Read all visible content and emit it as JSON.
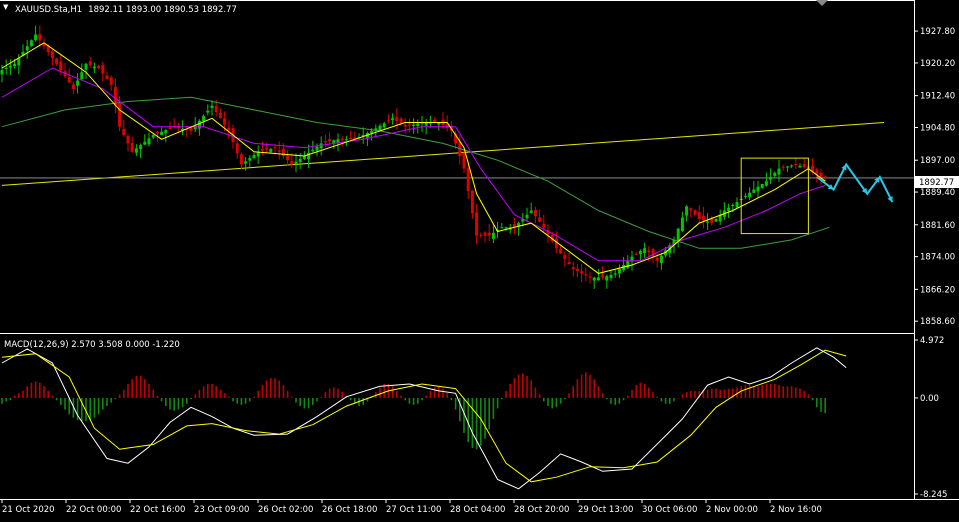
{
  "header": {
    "symbol_label": "XAUUSD.Sta,H1",
    "ohlc": "1892.11 1893.00 1890.53 1892.77"
  },
  "macd_header": {
    "label": "MACD(12,26,9) 2.570 3.508 0.000 -1.220"
  },
  "colors": {
    "background": "#000000",
    "bull": "#00c800",
    "bear": "#e00000",
    "ma_fast": "#ffff00",
    "ma_mid": "#c000ff",
    "ma_slow": "#3f9f3f",
    "trendline": "#e6e60a",
    "box": "#e6e60a",
    "forecast": "#29c8e8",
    "price_label_bg": "#ffffff",
    "histogram_pos": "#c00000",
    "histogram_neg": "#0e8a0e"
  },
  "current_price": "1892.77",
  "chart_data": [
    {
      "type": "candlestick",
      "title": "XAUUSD.Sta,H1",
      "ylim": [
        1856.5,
        1934.5
      ],
      "y_ticks": [
        "1927.80",
        "1920.20",
        "1912.40",
        "1904.80",
        "1897.00",
        "1889.40",
        "1881.60",
        "1874.00",
        "1866.20",
        "1858.60"
      ],
      "x_ticks": [
        "21 Oct 2020",
        "22 Oct 00:00",
        "22 Oct 16:00",
        "23 Oct 09:00",
        "26 Oct 02:00",
        "26 Oct 18:00",
        "27 Oct 11:00",
        "28 Oct 04:00",
        "28 Oct 20:00",
        "29 Oct 13:00",
        "30 Oct 06:00",
        "2 Nov 00:00",
        "2 Nov 16:00"
      ],
      "price_path": [
        [
          0,
          1918
        ],
        [
          4,
          1920
        ],
        [
          9,
          1927
        ],
        [
          14,
          1920
        ],
        [
          18,
          1914
        ],
        [
          21,
          1920
        ],
        [
          24,
          1919
        ],
        [
          27,
          1915
        ],
        [
          29,
          1905
        ],
        [
          32,
          1899
        ],
        [
          37,
          1903
        ],
        [
          42,
          1905
        ],
        [
          46,
          1904
        ],
        [
          51,
          1910
        ],
        [
          55,
          1904
        ],
        [
          58,
          1896
        ],
        [
          62,
          1899
        ],
        [
          66,
          1900
        ],
        [
          70,
          1896
        ],
        [
          73,
          1898
        ],
        [
          77,
          1901
        ],
        [
          81,
          1902
        ],
        [
          85,
          1902
        ],
        [
          89,
          1904
        ],
        [
          94,
          1907
        ],
        [
          97,
          1905
        ],
        [
          101,
          1906
        ],
        [
          105,
          1906
        ],
        [
          108,
          1904
        ],
        [
          111,
          1895
        ],
        [
          114,
          1879
        ],
        [
          117,
          1879
        ],
        [
          120,
          1881
        ],
        [
          123,
          1881
        ],
        [
          127,
          1885
        ],
        [
          130,
          1881
        ],
        [
          133,
          1876
        ],
        [
          137,
          1871
        ],
        [
          141,
          1869
        ],
        [
          144,
          1869
        ],
        [
          147,
          1870
        ],
        [
          151,
          1874
        ],
        [
          154,
          1876
        ],
        [
          157,
          1873
        ],
        [
          161,
          1878
        ],
        [
          164,
          1886
        ],
        [
          167,
          1883
        ],
        [
          170,
          1882
        ],
        [
          173,
          1885
        ],
        [
          176,
          1887
        ],
        [
          180,
          1890
        ],
        [
          183,
          1892
        ],
        [
          186,
          1895
        ],
        [
          190,
          1896
        ],
        [
          193,
          1895
        ],
        [
          196,
          1892.8
        ]
      ],
      "ma_fast": [
        [
          0,
          1919
        ],
        [
          10,
          1925
        ],
        [
          20,
          1918
        ],
        [
          28,
          1909
        ],
        [
          38,
          1902
        ],
        [
          50,
          1907
        ],
        [
          60,
          1899
        ],
        [
          72,
          1898
        ],
        [
          84,
          1902
        ],
        [
          96,
          1906
        ],
        [
          106,
          1906
        ],
        [
          110,
          1900
        ],
        [
          113,
          1889
        ],
        [
          118,
          1880
        ],
        [
          126,
          1882
        ],
        [
          134,
          1876
        ],
        [
          142,
          1870
        ],
        [
          150,
          1872
        ],
        [
          158,
          1875
        ],
        [
          166,
          1882
        ],
        [
          174,
          1885
        ],
        [
          184,
          1890
        ],
        [
          192,
          1895
        ],
        [
          196,
          1892
        ]
      ],
      "ma_mid": [
        [
          0,
          1912
        ],
        [
          12,
          1919
        ],
        [
          24,
          1914
        ],
        [
          36,
          1905
        ],
        [
          48,
          1905
        ],
        [
          60,
          1901
        ],
        [
          72,
          1900
        ],
        [
          86,
          1902
        ],
        [
          100,
          1905
        ],
        [
          108,
          1905
        ],
        [
          114,
          1895
        ],
        [
          122,
          1884
        ],
        [
          132,
          1879
        ],
        [
          142,
          1873
        ],
        [
          152,
          1873
        ],
        [
          162,
          1878
        ],
        [
          172,
          1881
        ],
        [
          182,
          1885
        ],
        [
          190,
          1889
        ],
        [
          196,
          1891
        ]
      ],
      "ma_slow": [
        [
          0,
          1905
        ],
        [
          15,
          1909
        ],
        [
          30,
          1911
        ],
        [
          45,
          1912
        ],
        [
          60,
          1909
        ],
        [
          75,
          1906
        ],
        [
          90,
          1904
        ],
        [
          105,
          1901
        ],
        [
          118,
          1897
        ],
        [
          130,
          1892
        ],
        [
          142,
          1885
        ],
        [
          154,
          1880
        ],
        [
          166,
          1876
        ],
        [
          176,
          1876
        ],
        [
          188,
          1878
        ],
        [
          197,
          1881
        ]
      ],
      "trendline": [
        [
          0,
          1891
        ],
        [
          210,
          1906
        ]
      ],
      "hline": 1892.77,
      "box": {
        "x": [
          176,
          192
        ],
        "y": [
          1879.5,
          1897.5
        ]
      },
      "forecast": [
        [
          194,
          1893
        ],
        [
          198,
          1890
        ],
        [
          201,
          1896
        ],
        [
          206,
          1889
        ],
        [
          209,
          1893
        ],
        [
          212,
          1887
        ]
      ]
    },
    {
      "type": "macd",
      "title": "MACD(12,26,9)",
      "values": {
        "macd": 2.57,
        "signal": 3.508,
        "extra1": 0.0,
        "extra2": -1.22
      },
      "ylim": [
        -8.245,
        4.972
      ],
      "y_ticks": [
        "4.972",
        "0.00",
        "-8.245"
      ],
      "histogram": [
        -0.5,
        -0.3,
        -0.2,
        0.2,
        0.4,
        0.6,
        1.0,
        1.3,
        1.4,
        1.3,
        1.0,
        0.6,
        0.2,
        -0.2,
        -0.6,
        -1.0,
        -1.4,
        -1.7,
        -1.9,
        -2.0,
        -2.0,
        -1.9,
        -1.7,
        -1.4,
        -1.0,
        -0.7,
        -0.4,
        -0.1,
        0.3,
        0.7,
        1.2,
        1.6,
        1.9,
        1.9,
        1.6,
        1.2,
        0.7,
        0.2,
        -0.3,
        -0.7,
        -1.0,
        -1.1,
        -1.0,
        -0.8,
        -0.5,
        -0.1,
        0.3,
        0.7,
        1.0,
        1.2,
        1.2,
        1.0,
        0.7,
        0.4,
        0.1,
        -0.3,
        -0.5,
        -0.6,
        -0.5,
        -0.3,
        0.1,
        0.6,
        1.1,
        1.5,
        1.7,
        1.7,
        1.5,
        1.1,
        0.6,
        0.1,
        -0.4,
        -0.7,
        -0.9,
        -0.9,
        -0.6,
        -0.3,
        0.1,
        0.5,
        0.8,
        0.9,
        0.8,
        0.5,
        0.2,
        -0.2,
        -0.5,
        -0.7,
        -0.6,
        -0.3,
        0.1,
        0.5,
        0.9,
        1.2,
        1.2,
        1.0,
        0.6,
        0.2,
        -0.2,
        -0.5,
        -0.6,
        -0.5,
        -0.2,
        0.2,
        0.6,
        0.9,
        1.0,
        0.8,
        0.4,
        -0.2,
        -1.0,
        -2.0,
        -3.0,
        -3.8,
        -4.3,
        -4.4,
        -4.1,
        -3.5,
        -2.7,
        -1.8,
        -0.9,
        -0.1,
        0.6,
        1.2,
        1.7,
        2.0,
        2.1,
        1.9,
        1.5,
        0.9,
        0.3,
        -0.3,
        -0.7,
        -0.9,
        -0.8,
        -0.5,
        -0.1,
        0.4,
        1.0,
        1.6,
        2.0,
        2.2,
        2.0,
        1.6,
        1.0,
        0.4,
        -0.1,
        -0.5,
        -0.6,
        -0.5,
        -0.2,
        0.2,
        0.7,
        1.1,
        1.3,
        1.2,
        0.9,
        0.5,
        0.1,
        -0.3,
        -0.5,
        -0.5,
        -0.3,
        0.0,
        0.3,
        0.5,
        0.6,
        0.6,
        0.6,
        0.7,
        0.7,
        0.8,
        0.8,
        0.7,
        0.7,
        0.8,
        0.8,
        0.9,
        1.0,
        1.1,
        1.1,
        1.0,
        1.0,
        1.1,
        1.2,
        1.2,
        1.2,
        1.1,
        1.0,
        1.0,
        1.0,
        0.9,
        0.8,
        0.6,
        0.3,
        -0.2,
        -0.8,
        -1.2,
        -1.3
      ],
      "macd_line": [
        [
          0,
          3.0
        ],
        [
          6,
          4.2
        ],
        [
          12,
          3.0
        ],
        [
          18,
          -1.5
        ],
        [
          25,
          -5.2
        ],
        [
          30,
          -5.6
        ],
        [
          35,
          -4.2
        ],
        [
          40,
          -2.1
        ],
        [
          45,
          -0.8
        ],
        [
          50,
          -1.6
        ],
        [
          55,
          -2.6
        ],
        [
          60,
          -3.2
        ],
        [
          68,
          -3.1
        ],
        [
          75,
          -1.6
        ],
        [
          82,
          0.1
        ],
        [
          90,
          1.0
        ],
        [
          97,
          1.2
        ],
        [
          104,
          0.6
        ],
        [
          108,
          0.4
        ],
        [
          112,
          -3.0
        ],
        [
          118,
          -7.0
        ],
        [
          123,
          -7.8
        ],
        [
          128,
          -6.4
        ],
        [
          133,
          -4.8
        ],
        [
          138,
          -5.5
        ],
        [
          143,
          -6.3
        ],
        [
          150,
          -6.1
        ],
        [
          157,
          -3.6
        ],
        [
          162,
          -1.8
        ],
        [
          168,
          1.1
        ],
        [
          173,
          1.8
        ],
        [
          178,
          1.2
        ],
        [
          183,
          1.8
        ],
        [
          188,
          3.0
        ],
        [
          194,
          4.3
        ],
        [
          198,
          3.5
        ],
        [
          201,
          2.6
        ]
      ],
      "signal_line": [
        [
          0,
          3.5
        ],
        [
          8,
          3.8
        ],
        [
          16,
          1.8
        ],
        [
          22,
          -2.6
        ],
        [
          28,
          -4.4
        ],
        [
          36,
          -4.0
        ],
        [
          44,
          -2.4
        ],
        [
          50,
          -2.2
        ],
        [
          58,
          -2.8
        ],
        [
          66,
          -3.1
        ],
        [
          74,
          -2.3
        ],
        [
          82,
          -0.7
        ],
        [
          92,
          0.6
        ],
        [
          100,
          1.2
        ],
        [
          108,
          0.8
        ],
        [
          114,
          -1.8
        ],
        [
          120,
          -5.6
        ],
        [
          126,
          -7.2
        ],
        [
          132,
          -6.8
        ],
        [
          140,
          -5.9
        ],
        [
          148,
          -6.0
        ],
        [
          156,
          -5.5
        ],
        [
          164,
          -3.2
        ],
        [
          170,
          -0.8
        ],
        [
          176,
          0.6
        ],
        [
          184,
          1.6
        ],
        [
          190,
          2.8
        ],
        [
          196,
          4.1
        ],
        [
          201,
          3.6
        ]
      ]
    }
  ]
}
